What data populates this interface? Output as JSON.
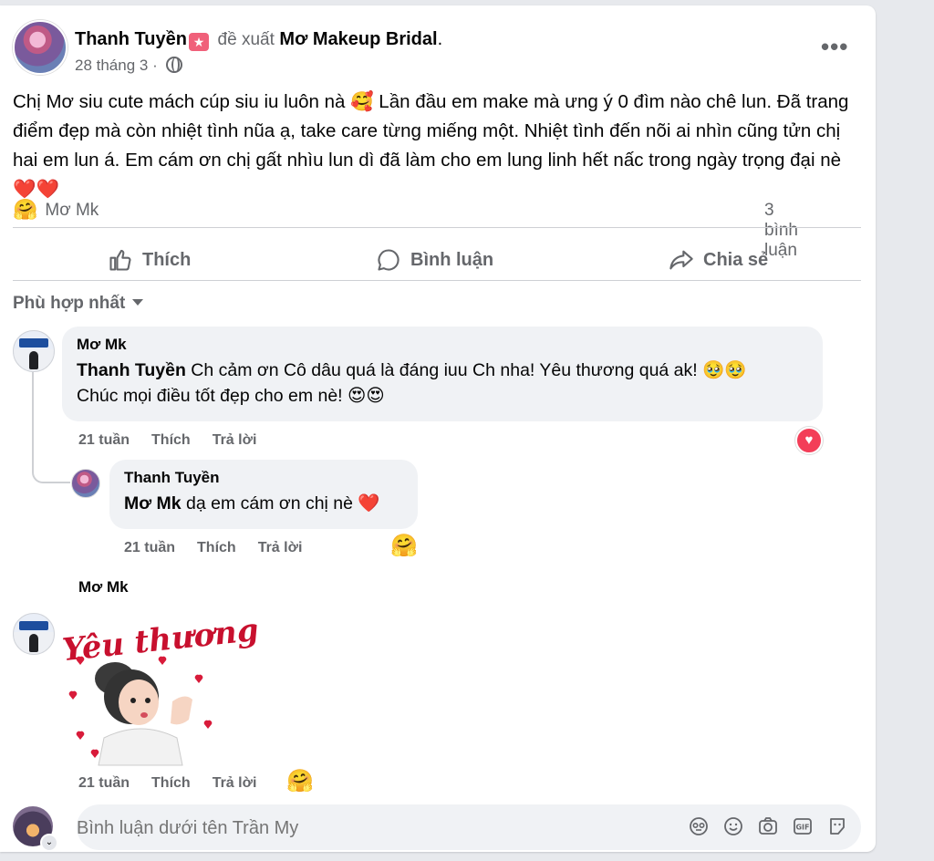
{
  "post": {
    "author": "Thanh Tuyền",
    "badge_icon": "recommend-badge-icon",
    "recommends_text": "đề xuất",
    "page_name": "Mơ Makeup Bridal",
    "page_period": ".",
    "date": "28 tháng 3",
    "date_sep": "·",
    "privacy_icon": "globe-icon",
    "more_label": "•••",
    "text": "Chị Mơ siu cute mách cúp siu iu luôn nà 🥰 Lần đầu em make mà ưng ý 0 đìm nào chê lun. Đã trang điểm đẹp mà còn nhiệt tình nũa ạ, take care từng miếng một. Nhiệt tình đến nõi ai nhìn cũng tửn chị hai em lun á. Em cám ơn chị gất nhìu lun dì đã làm cho em lung linh hết nấc trong ngày trọng đại nè ❤️❤️",
    "reaction_emoji": "🤗",
    "reaction_name": "Mơ Mk",
    "comment_count": "3 bình luận"
  },
  "actions": {
    "like": "Thích",
    "comment": "Bình luận",
    "share": "Chia sẻ"
  },
  "sort": {
    "label": "Phù hợp nhất"
  },
  "comments": [
    {
      "author": "Mơ Mk",
      "mention": "Thanh Tuyền",
      "text_line1": " Ch cảm ơn Cô dâu quá là đáng iuu Ch nha! Yêu thương quá ak! 🥹🥹",
      "text_line2": "Chúc mọi điều tốt đẹp cho em nè! 😍😍",
      "time": "21 tuần",
      "like": "Thích",
      "reply": "Trả lời",
      "reaction": "♥"
    },
    {
      "author": "Thanh Tuyền",
      "mention": "Mơ Mk",
      "text": " dạ em cám ơn chị nè ❤️",
      "time": "21 tuần",
      "like": "Thích",
      "reply": "Trả lời",
      "reaction": "🤗"
    },
    {
      "author": "Mơ Mk",
      "sticker_text": "Yêu thương",
      "time": "21 tuần",
      "like": "Thích",
      "reply": "Trả lời",
      "reaction": "🤗"
    }
  ],
  "composer": {
    "placeholder": "Bình luận dưới tên Trần My"
  },
  "colors": {
    "accent_red": "#f33e58",
    "muted_text": "#65676b",
    "bubble_bg": "#f0f2f5"
  }
}
